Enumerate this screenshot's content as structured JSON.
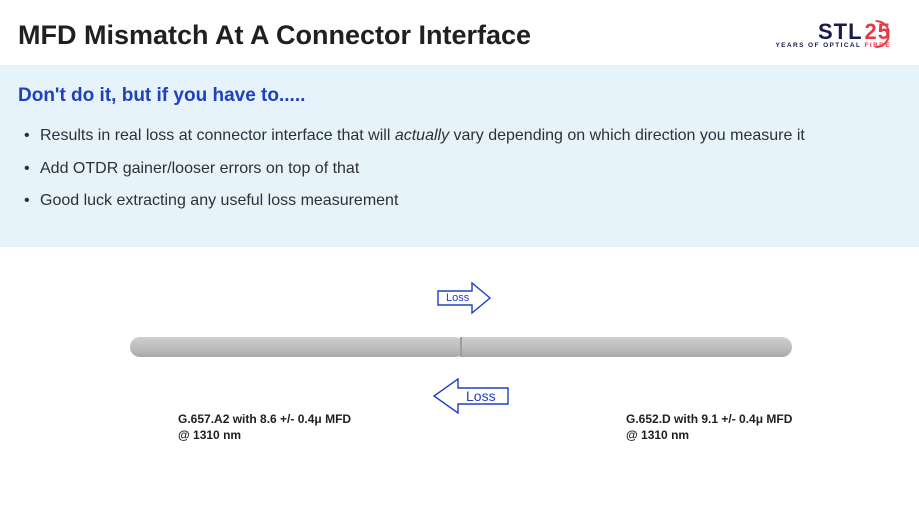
{
  "header": {
    "title": "MFD Mismatch At A Connector Interface",
    "logo_text": "STL",
    "logo_num": "25",
    "logo_tag_a": "YEARS OF OPTICAL ",
    "logo_tag_b": "FIBRE"
  },
  "content": {
    "subtitle": "Don't do it, but if you have to.....",
    "bullets": [
      "Results in real loss at connector interface that will <em>actually</em> vary depending on which direction you measure it",
      "Add OTDR gainer/looser errors on top of that",
      "Good luck extracting any useful loss measurement"
    ]
  },
  "diagram": {
    "arrow_top_label": "Loss",
    "arrow_bottom_label": "Loss",
    "left_spec_line1": "G.657.A2 with 8.6 +/- 0.4μ MFD",
    "left_spec_line2": "@ 1310 nm",
    "right_spec_line1": "G.652.D with 9.1 +/- 0.4μ MFD",
    "right_spec_line2": "@ 1310 nm"
  }
}
